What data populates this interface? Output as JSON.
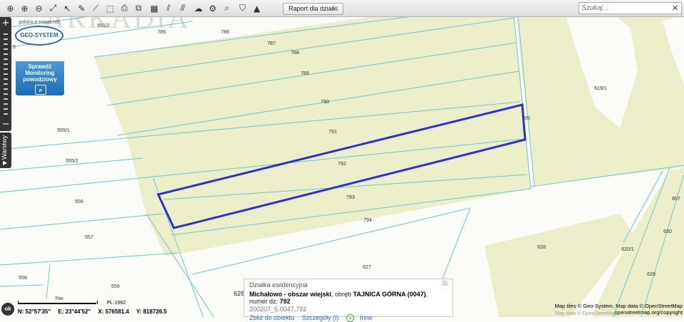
{
  "toolbar": {
    "icons": [
      {
        "name": "locate-icon",
        "glyph": "⊕"
      },
      {
        "name": "zoom-in-icon",
        "glyph": "⊕"
      },
      {
        "name": "zoom-out-icon",
        "glyph": "⊖"
      },
      {
        "name": "full-extent-icon",
        "glyph": "⤢"
      },
      {
        "name": "pan-arrow-icon",
        "glyph": "↖"
      },
      {
        "name": "pencil-icon",
        "glyph": "✎"
      },
      {
        "name": "ruler-icon",
        "glyph": "⟋"
      },
      {
        "name": "area-measure-icon",
        "glyph": "⬚"
      },
      {
        "name": "print-icon",
        "glyph": "⎙"
      },
      {
        "name": "export-icon",
        "glyph": "⧉"
      },
      {
        "name": "grid-icon",
        "glyph": "▦"
      },
      {
        "name": "draw-lines-icon",
        "glyph": "⫽"
      },
      {
        "name": "hatch-icon",
        "glyph": "⫻"
      },
      {
        "name": "cloud-icon",
        "glyph": "☁"
      },
      {
        "name": "settings-icon",
        "glyph": "⚙"
      },
      {
        "name": "search-map-icon",
        "glyph": "⌕"
      },
      {
        "name": "street-view-icon",
        "glyph": "⛉"
      },
      {
        "name": "pyramid-icon",
        "glyph": "▲"
      }
    ],
    "raport_label": "Raport dla działki"
  },
  "search": {
    "placeholder": "Szukaj..."
  },
  "watermark": "ARKADIA",
  "geo_widget": {
    "url": "polska.e-mapa.net",
    "logo": "GEO-SYSTEM",
    "title_lines": [
      "Sprawdź",
      "Monitoring",
      "powodziowy"
    ]
  },
  "layers_tab": "Warstwy",
  "parcels": [
    "551/2",
    "785",
    "786",
    "787",
    "788",
    "789",
    "790",
    "791",
    "792",
    "793",
    "794",
    "795",
    "555/1",
    "555/2",
    "556",
    "557",
    "558",
    "559",
    "619/1",
    "620/1",
    "626",
    "627",
    "628",
    "629",
    "630",
    "807",
    "5"
  ],
  "info_popup": {
    "category": "Działka ewidencyjna",
    "place": "Michałowo - obszar wiejski",
    "obreb_label": "obręb",
    "obreb": "TAJNICA GÓRNA (0047)",
    "numer_label": "numer dz.",
    "numer": "792",
    "id": "200207_5.0047.792",
    "link_zoom": "Zbliż do obiektu",
    "link_details": "Szczegóły (I)",
    "link_other": "Inne",
    "marker_label": "626"
  },
  "status": {
    "ok": "ok",
    "lat": "N: 52°57'35\"",
    "lon": "E: 23°44'52\"",
    "x": "X: 576581.4",
    "y": "Y: 818726.5",
    "scale_label": "70m",
    "crs": "PL-1992",
    "attrib1": "Map tiles © Geo-System, Map data © OpenStreetMap",
    "attrib2": "openstreetmap.org/copyright",
    "attrib3": "Map data © OpenStreetMap"
  },
  "colors": {
    "field": "#ecedc9",
    "parcel_line": "#6fc6d6",
    "selection": "#2f2fd0",
    "background": "#fbfbf7"
  }
}
